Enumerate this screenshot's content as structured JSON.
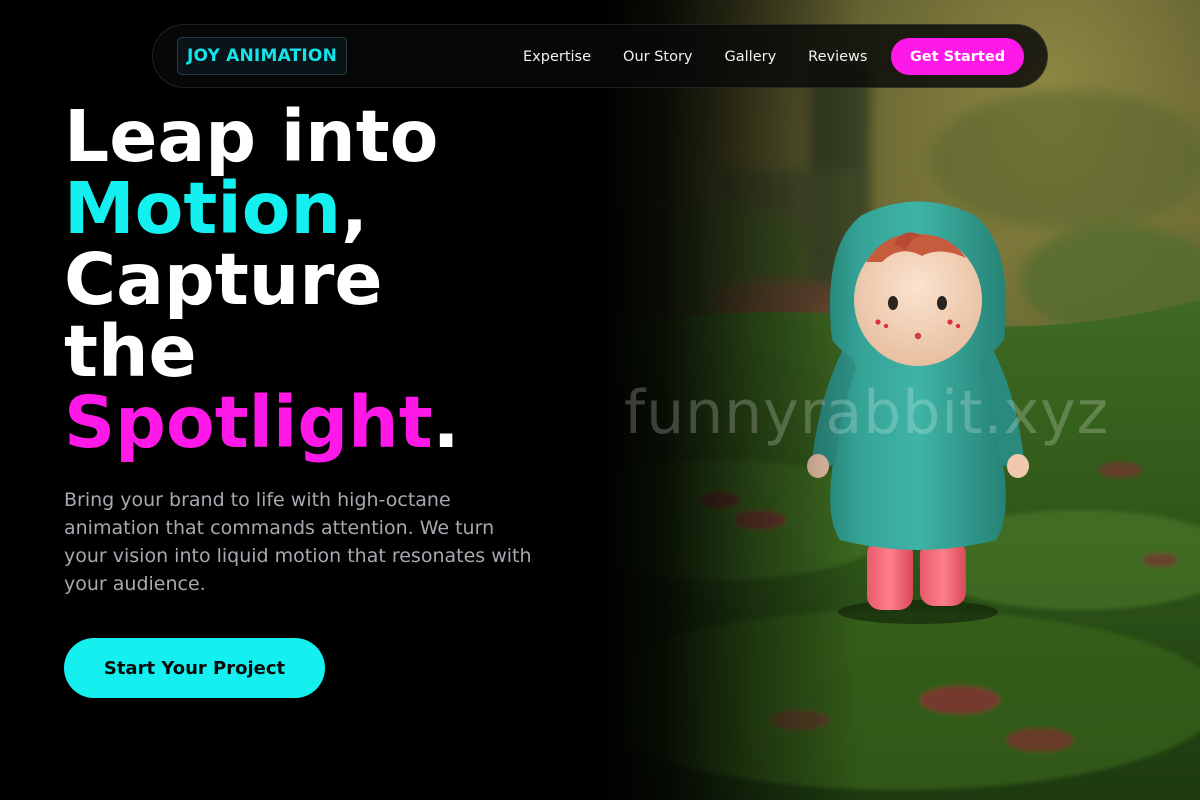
{
  "brand": {
    "logo_text": "JOY ANIMATION"
  },
  "nav": {
    "links": [
      "Expertise",
      "Our Story",
      "Gallery",
      "Reviews"
    ],
    "cta_label": "Get Started"
  },
  "hero": {
    "headline": {
      "line1": "Leap into",
      "accent1": "Motion",
      "punct1": ",",
      "line3": "Capture",
      "line4": "the",
      "accent2": "Spotlight",
      "punct2": "."
    },
    "lede": "Bring your brand to life with high-octane animation that commands attention. We turn your vision into liquid motion that resonates with your audience.",
    "cta_label": "Start Your Project",
    "image_watermark": "funnyrabbit.xyz"
  },
  "colors": {
    "accent_cyan": "#14f0f0",
    "accent_magenta": "#ff19e8",
    "background": "#000000"
  }
}
